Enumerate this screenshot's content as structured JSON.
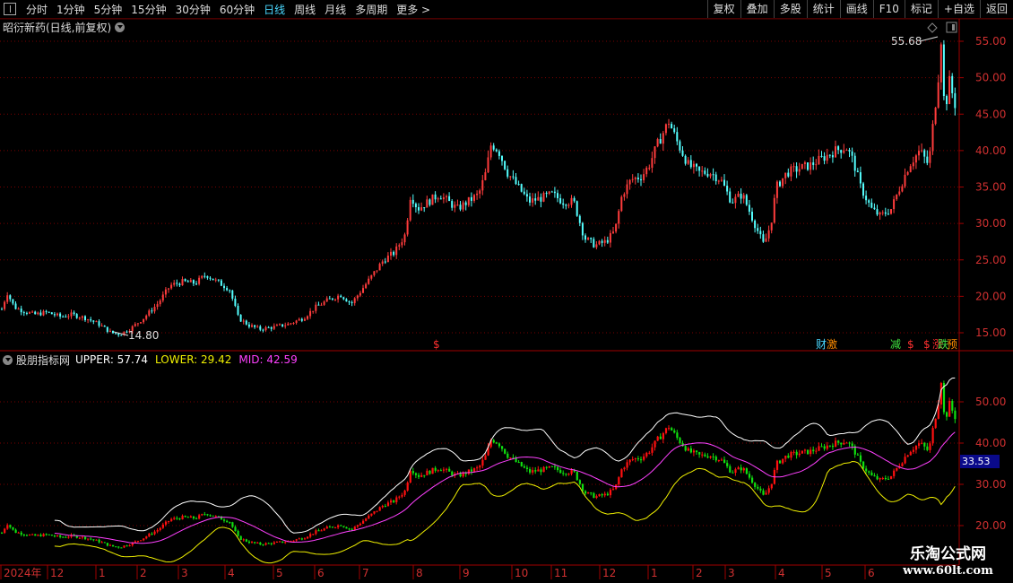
{
  "toolbar": {
    "periods": [
      "分时",
      "1分钟",
      "5分钟",
      "15分钟",
      "30分钟",
      "60分钟",
      "日线",
      "周线",
      "月线",
      "多周期",
      "更多 >"
    ],
    "active_period": "日线",
    "actions": [
      "复权",
      "叠加",
      "多股",
      "统计",
      "画线",
      "F10",
      "标记",
      "+自选",
      "返回"
    ]
  },
  "main_panel": {
    "stock_title": "昭衍新药(日线,前复权)",
    "high_label": "55.68",
    "low_label": "14.80",
    "event_marks": [
      {
        "text": "$",
        "color": "#ff3030"
      },
      {
        "text": "财",
        "color": "#4ad8ff"
      },
      {
        "text": "激",
        "color": "#ff8c00"
      },
      {
        "text": "减",
        "color": "#40e040"
      },
      {
        "text": "$",
        "color": "#ff3030"
      },
      {
        "text": "$",
        "color": "#ff3030"
      },
      {
        "text": "涨",
        "color": "#ff3030"
      },
      {
        "text": "跌",
        "color": "#40e040"
      },
      {
        "text": "预",
        "color": "#ff8c00"
      }
    ]
  },
  "indicator_panel": {
    "title": "股朋指标网",
    "upper_label": "UPPER: 57.74",
    "lower_label": "LOWER: 29.42",
    "mid_label": "MID: 42.59",
    "current_value_tag": "33.53"
  },
  "chart_data": [
    {
      "type": "candlestick",
      "title": "昭衍新药(日线,前复权)",
      "y_ticks": [
        "55.00",
        "50.00",
        "45.00",
        "40.00",
        "35.00",
        "30.00",
        "25.00",
        "20.00",
        "15.00"
      ],
      "ylim": [
        13.5,
        58
      ],
      "annotations": [
        {
          "label": "55.68",
          "kind": "period high"
        },
        {
          "label": "14.80",
          "kind": "period low"
        }
      ],
      "grid": true,
      "approx_close_path": [
        [
          0,
          17.5
        ],
        [
          8,
          20.5
        ],
        [
          16,
          18.5
        ],
        [
          26,
          18
        ],
        [
          38,
          17.5
        ],
        [
          52,
          17.8
        ],
        [
          68,
          17.2
        ],
        [
          80,
          17.5
        ],
        [
          96,
          17
        ],
        [
          110,
          16.2
        ],
        [
          124,
          15
        ],
        [
          134,
          14.8
        ],
        [
          146,
          15.6
        ],
        [
          160,
          17
        ],
        [
          176,
          19
        ],
        [
          190,
          21.5
        ],
        [
          204,
          22
        ],
        [
          218,
          21.8
        ],
        [
          230,
          23
        ],
        [
          242,
          22
        ],
        [
          256,
          21
        ],
        [
          266,
          17
        ],
        [
          278,
          16
        ],
        [
          290,
          15.5
        ],
        [
          306,
          15.8
        ],
        [
          322,
          16.2
        ],
        [
          338,
          17
        ],
        [
          352,
          18.5
        ],
        [
          366,
          19.5
        ],
        [
          380,
          20.2
        ],
        [
          392,
          19
        ],
        [
          404,
          21
        ],
        [
          416,
          23
        ],
        [
          428,
          25
        ],
        [
          440,
          26
        ],
        [
          452,
          28.5
        ],
        [
          458,
          34
        ],
        [
          466,
          32
        ],
        [
          478,
          33
        ],
        [
          490,
          34
        ],
        [
          500,
          33
        ],
        [
          510,
          32
        ],
        [
          522,
          33
        ],
        [
          534,
          34
        ],
        [
          542,
          37
        ],
        [
          548,
          41
        ],
        [
          556,
          40
        ],
        [
          566,
          37
        ],
        [
          578,
          35
        ],
        [
          590,
          33
        ],
        [
          604,
          33.5
        ],
        [
          616,
          34
        ],
        [
          628,
          33
        ],
        [
          640,
          33
        ],
        [
          652,
          28
        ],
        [
          664,
          27
        ],
        [
          676,
          27.5
        ],
        [
          686,
          29
        ],
        [
          694,
          34
        ],
        [
          704,
          36
        ],
        [
          716,
          36.5
        ],
        [
          724,
          38
        ],
        [
          734,
          41
        ],
        [
          746,
          44
        ],
        [
          756,
          41
        ],
        [
          768,
          38
        ],
        [
          780,
          37
        ],
        [
          792,
          37
        ],
        [
          804,
          36
        ],
        [
          816,
          33
        ],
        [
          828,
          34
        ],
        [
          840,
          30.5
        ],
        [
          852,
          27
        ],
        [
          860,
          30
        ],
        [
          866,
          35
        ],
        [
          878,
          37
        ],
        [
          890,
          37.5
        ],
        [
          904,
          38
        ],
        [
          918,
          39
        ],
        [
          932,
          40
        ],
        [
          944,
          40.5
        ],
        [
          952,
          38.5
        ],
        [
          960,
          35
        ],
        [
          972,
          32
        ],
        [
          982,
          31
        ],
        [
          994,
          32
        ],
        [
          1004,
          35
        ],
        [
          1014,
          38
        ],
        [
          1026,
          40
        ],
        [
          1036,
          38
        ],
        [
          1042,
          45
        ],
        [
          1046,
          49
        ],
        [
          1050,
          55.68
        ],
        [
          1054,
          44
        ],
        [
          1058,
          50
        ],
        [
          1062,
          48
        ],
        [
          1066,
          46
        ]
      ]
    },
    {
      "type": "line",
      "title": "股朋指标网",
      "series": [
        {
          "name": "UPPER",
          "color": "#ffffff",
          "last_value": 57.74
        },
        {
          "name": "LOWER",
          "color": "#f0f000",
          "last_value": 29.42
        },
        {
          "name": "MID",
          "color": "#ff40ff",
          "last_value": 42.59
        }
      ],
      "y_ticks": [
        "50.00",
        "40.00",
        "30.00",
        "20.00"
      ],
      "ylim": [
        15,
        60
      ],
      "x_labels": [
        "2024年",
        "12",
        "1",
        "2",
        "3",
        "4",
        "5",
        "6",
        "7",
        "8",
        "9",
        "10",
        "11",
        "12",
        "1",
        "2",
        "3",
        "4",
        "5",
        "6"
      ]
    }
  ]
}
